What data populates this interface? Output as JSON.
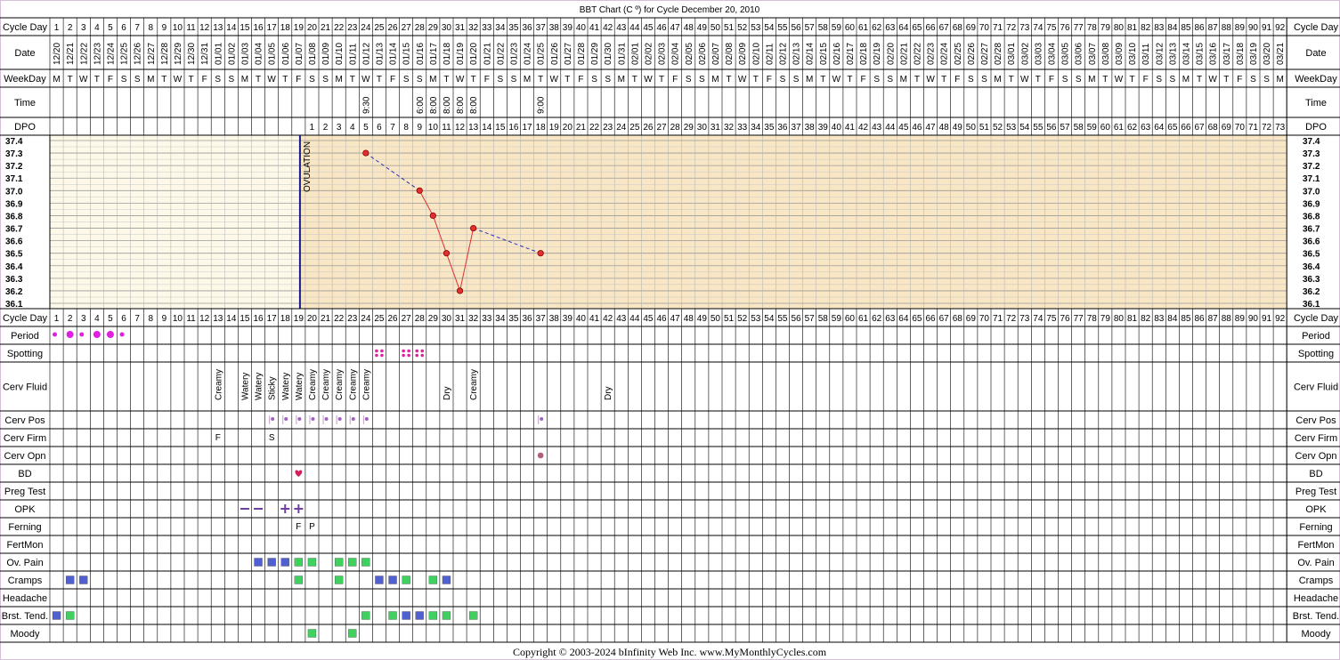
{
  "chart_data": {
    "type": "line",
    "title": "BBT Chart (C º) for Cycle December 20, 2010",
    "ylim": [
      36.1,
      37.4
    ],
    "y_ticks": [
      "37.4",
      "37.3",
      "37.2",
      "37.1",
      "37.0",
      "36.9",
      "36.8",
      "36.7",
      "36.6",
      "36.5",
      "36.4",
      "36.3",
      "36.2",
      "36.1"
    ],
    "ovulation_day": 19,
    "ovulation_label": "OVULATION",
    "dates": [
      "12/20",
      "12/21",
      "12/22",
      "12/23",
      "12/24",
      "12/25",
      "12/26",
      "12/27",
      "12/28",
      "12/29",
      "12/30",
      "12/31",
      "01/01",
      "01/02",
      "01/03",
      "01/04",
      "01/05",
      "01/06",
      "01/07",
      "01/08",
      "01/09",
      "01/10",
      "01/11",
      "01/12",
      "01/13",
      "01/14",
      "01/15",
      "01/16",
      "01/17",
      "01/18",
      "01/19",
      "01/20",
      "01/21",
      "01/22",
      "01/23",
      "01/24",
      "01/25",
      "01/26",
      "01/27",
      "01/28",
      "01/29",
      "01/30",
      "01/31",
      "02/01",
      "02/02",
      "02/03",
      "02/04",
      "02/05",
      "02/06",
      "02/07",
      "02/08",
      "02/09",
      "02/10",
      "02/11",
      "02/12",
      "02/13",
      "02/14",
      "02/15",
      "02/16",
      "02/17",
      "02/18",
      "02/19",
      "02/20",
      "02/21",
      "02/22",
      "02/23",
      "02/24",
      "02/25",
      "02/26",
      "02/27",
      "02/28",
      "03/01",
      "03/02",
      "03/03",
      "03/04",
      "03/05",
      "03/06",
      "03/07",
      "03/08",
      "03/09",
      "03/10",
      "03/11",
      "03/12",
      "03/13",
      "03/14",
      "03/15",
      "03/16",
      "03/17",
      "03/18",
      "03/19",
      "03/20",
      "03/21"
    ],
    "weekdays": [
      "M",
      "T",
      "W",
      "T",
      "F",
      "S",
      "S",
      "M",
      "T",
      "W",
      "T",
      "F",
      "S",
      "S",
      "M",
      "T",
      "W",
      "T",
      "F",
      "S",
      "S",
      "M",
      "T",
      "W",
      "T",
      "F",
      "S",
      "S",
      "M",
      "T",
      "W",
      "T",
      "F",
      "S",
      "S",
      "M",
      "T",
      "W",
      "T",
      "F",
      "S",
      "S",
      "M",
      "T",
      "W",
      "T",
      "F",
      "S",
      "S",
      "M",
      "T",
      "W",
      "T",
      "F",
      "S",
      "S",
      "M",
      "T",
      "W",
      "T",
      "F",
      "S",
      "S",
      "M",
      "T",
      "W",
      "T",
      "F",
      "S",
      "S",
      "M",
      "T",
      "W",
      "T",
      "F",
      "S",
      "S",
      "M",
      "T",
      "W",
      "T",
      "F",
      "S",
      "S",
      "M",
      "T",
      "W",
      "T",
      "F",
      "S",
      "S",
      "M"
    ],
    "times": [
      {
        "day": 24,
        "value": "9:30"
      },
      {
        "day": 28,
        "value": "6:00"
      },
      {
        "day": 29,
        "value": "8:00"
      },
      {
        "day": 30,
        "value": "8:00"
      },
      {
        "day": 31,
        "value": "8:00"
      },
      {
        "day": 32,
        "value": "8:00"
      },
      {
        "day": 37,
        "value": "9:00"
      }
    ],
    "temps": [
      {
        "day": 24,
        "value": 37.3
      },
      {
        "day": 28,
        "value": 37.0
      },
      {
        "day": 29,
        "value": 36.8
      },
      {
        "day": 30,
        "value": 36.5
      },
      {
        "day": 31,
        "value": 36.2
      },
      {
        "day": 32,
        "value": 36.7
      },
      {
        "day": 37,
        "value": 36.5
      }
    ],
    "period": [
      {
        "day": 1,
        "size": "small"
      },
      {
        "day": 2,
        "size": "large"
      },
      {
        "day": 3,
        "size": "small"
      },
      {
        "day": 4,
        "size": "large"
      },
      {
        "day": 5,
        "size": "large"
      },
      {
        "day": 6,
        "size": "small"
      }
    ],
    "spotting": [
      25,
      27,
      28
    ],
    "cervical_fluid": [
      {
        "day": 13,
        "value": "Creamy"
      },
      {
        "day": 15,
        "value": "Watery"
      },
      {
        "day": 16,
        "value": "Watery"
      },
      {
        "day": 17,
        "value": "Sticky"
      },
      {
        "day": 18,
        "value": "Watery"
      },
      {
        "day": 19,
        "value": "Watery"
      },
      {
        "day": 20,
        "value": "Creamy"
      },
      {
        "day": 21,
        "value": "Creamy"
      },
      {
        "day": 22,
        "value": "Creamy"
      },
      {
        "day": 23,
        "value": "Creamy"
      },
      {
        "day": 24,
        "value": "Creamy"
      },
      {
        "day": 30,
        "value": "Dry"
      },
      {
        "day": 32,
        "value": "Creamy"
      },
      {
        "day": 42,
        "value": "Dry"
      }
    ],
    "cervical_position": [
      17,
      18,
      19,
      20,
      21,
      22,
      23,
      24,
      37
    ],
    "cervical_firmness": [
      {
        "day": 13,
        "value": "F"
      },
      {
        "day": 17,
        "value": "S"
      }
    ],
    "cervical_opening": [
      37
    ],
    "bd": [
      19
    ],
    "opk": [
      {
        "day": 15,
        "value": "–"
      },
      {
        "day": 16,
        "value": "–"
      },
      {
        "day": 18,
        "value": "+"
      },
      {
        "day": 19,
        "value": "+"
      }
    ],
    "ferning": [
      {
        "day": 19,
        "value": "F"
      },
      {
        "day": 20,
        "value": "P"
      }
    ],
    "symptoms": {
      "ov_pain": [
        {
          "day": 16,
          "color": "blue"
        },
        {
          "day": 17,
          "color": "blue"
        },
        {
          "day": 18,
          "color": "blue"
        },
        {
          "day": 19,
          "color": "green"
        },
        {
          "day": 20,
          "color": "green"
        },
        {
          "day": 22,
          "color": "green"
        },
        {
          "day": 23,
          "color": "green"
        },
        {
          "day": 24,
          "color": "green"
        }
      ],
      "cramps": [
        {
          "day": 2,
          "color": "blue"
        },
        {
          "day": 3,
          "color": "blue"
        },
        {
          "day": 19,
          "color": "green"
        },
        {
          "day": 22,
          "color": "green"
        },
        {
          "day": 25,
          "color": "blue"
        },
        {
          "day": 26,
          "color": "blue"
        },
        {
          "day": 27,
          "color": "green"
        },
        {
          "day": 29,
          "color": "green"
        },
        {
          "day": 30,
          "color": "blue"
        }
      ],
      "headache": [],
      "brst_tend": [
        {
          "day": 1,
          "color": "blue"
        },
        {
          "day": 2,
          "color": "green"
        },
        {
          "day": 24,
          "color": "green"
        },
        {
          "day": 26,
          "color": "green"
        },
        {
          "day": 27,
          "color": "blue"
        },
        {
          "day": 28,
          "color": "blue"
        },
        {
          "day": 29,
          "color": "green"
        },
        {
          "day": 30,
          "color": "green"
        },
        {
          "day": 32,
          "color": "green"
        }
      ],
      "moody": [
        {
          "day": 20,
          "color": "green"
        },
        {
          "day": 23,
          "color": "green"
        }
      ]
    }
  },
  "labels": {
    "cycle_day": "Cycle Day",
    "date": "Date",
    "weekday": "WeekDay",
    "time": "Time",
    "dpo": "DPO",
    "rows": [
      "Period",
      "Spotting",
      "Cerv Fluid",
      "Cerv Pos",
      "Cerv Firm",
      "Cerv Opn",
      "BD",
      "Preg Test",
      "OPK",
      "Ferning",
      "FertMon",
      "Ov. Pain",
      "Cramps",
      "Headache",
      "Brst. Tend.",
      "Moody"
    ]
  },
  "colors": {
    "border": "#d8bfd8",
    "pre_ovulation_bg": "#fdf8e8",
    "post_ovulation_bg": "#f8e6c4",
    "ovulation_line": "#1a1a8c",
    "temp_line": "#e03030",
    "temp_dash": "#3030c0",
    "period_dot": "#e020e0",
    "spotting_dot": "#e020a0",
    "cerv_pos": "#a060c0",
    "cerv_opn": "#b06070",
    "bd_heart": "#d02060",
    "opk": "#7040a0",
    "ferning": "#c040a0",
    "firm": "#c040a0",
    "symptom_blue": "#5060d0",
    "symptom_green": "#40d060"
  },
  "footer": "Copyright © 2003-2024 bInfinity Web Inc.     www.MyMonthlyCycles.com"
}
